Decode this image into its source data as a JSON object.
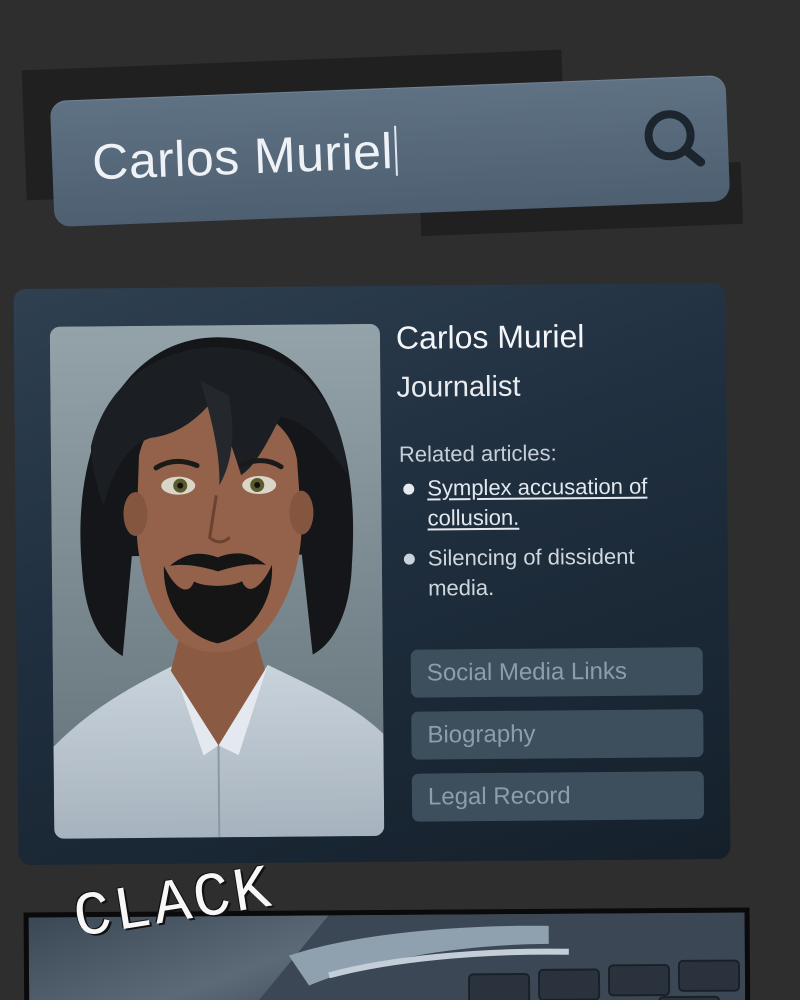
{
  "search": {
    "query": "Carlos Muriel",
    "button_icon": "search-icon"
  },
  "profile": {
    "name": "Carlos Muriel",
    "role": "Journalist",
    "related_heading": "Related articles:",
    "articles": [
      {
        "title": "Symplex accusation of collusion.",
        "linked": true
      },
      {
        "title": "Silencing of dissident media.",
        "linked": false
      }
    ],
    "buttons": {
      "social": "Social Media Links",
      "biography": "Biography",
      "legal": "Legal Record"
    }
  },
  "sfx": {
    "clack": "CLACK"
  },
  "colors": {
    "background": "#2e2e2e",
    "search_bar": "#56697b",
    "card": "#1f2d3a",
    "card_button": "#3d4e5d",
    "card_button_text": "#8e9dac"
  }
}
